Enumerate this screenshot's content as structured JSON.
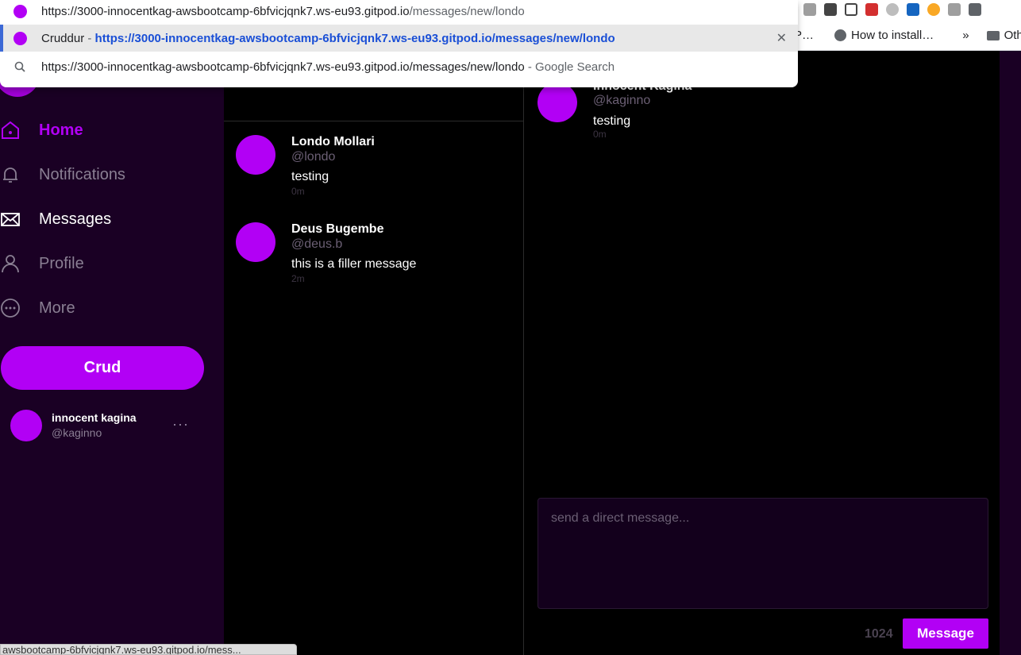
{
  "omnibox": {
    "input_text": "https://3000-innocentkag-awsbootcamp-6bfvicjqnk7.ws-eu93.gitpod.io/messages/new/londo",
    "input_prefix": "https://3000-innocentkag-awsbootcamp-6bfvicjqnk7.ws-eu93.gitpod.io",
    "input_path": "/messages/new/londo",
    "suggestion_title": "Cruddur",
    "suggestion_separator": " - ",
    "suggestion_url": "https://3000-innocentkag-awsbootcamp-6bfvicjqnk7.ws-eu93.gitpod.io/messages/new/londo",
    "search_text": "https://3000-innocentkag-awsbootcamp-6bfvicjqnk7.ws-eu93.gitpod.io/messages/new/londo",
    "search_suffix": " - Google Search"
  },
  "bookmarks": {
    "partial": "P…",
    "item": "How to install…",
    "overflow": "»",
    "other": "Oth"
  },
  "sidebar": {
    "nav": [
      {
        "label": "Home",
        "icon": "home-icon"
      },
      {
        "label": "Notifications",
        "icon": "bell-icon"
      },
      {
        "label": "Messages",
        "icon": "envelope-icon"
      },
      {
        "label": "Profile",
        "icon": "person-icon"
      },
      {
        "label": "More",
        "icon": "more-circle-icon"
      }
    ],
    "crud_button": "Crud",
    "profile": {
      "name": "innocent kagina",
      "handle": "@kaginno",
      "more": "···"
    }
  },
  "message_groups": [
    {
      "name": "Londo Mollari",
      "handle": "@londo",
      "message": "testing",
      "time": "0m"
    },
    {
      "name": "Deus Bugembe",
      "handle": "@deus.b",
      "message": "this is a filler message",
      "time": "2m"
    }
  ],
  "thread": {
    "messages": [
      {
        "name": "Innocent Kagina",
        "handle": "@kaginno",
        "message": "testing",
        "time": "0m"
      }
    ],
    "composer_placeholder": "send a direct message...",
    "char_count": "1024",
    "send_button": "Message"
  },
  "status_bar": "awsbootcamp-6bfvicjqnk7.ws-eu93.gitpod.io/mess...",
  "colors": {
    "accent": "#b200f5",
    "sidebar_bg": "#1a0024",
    "composer_bg": "#13001c",
    "link_blue": "#1a4fd6"
  }
}
